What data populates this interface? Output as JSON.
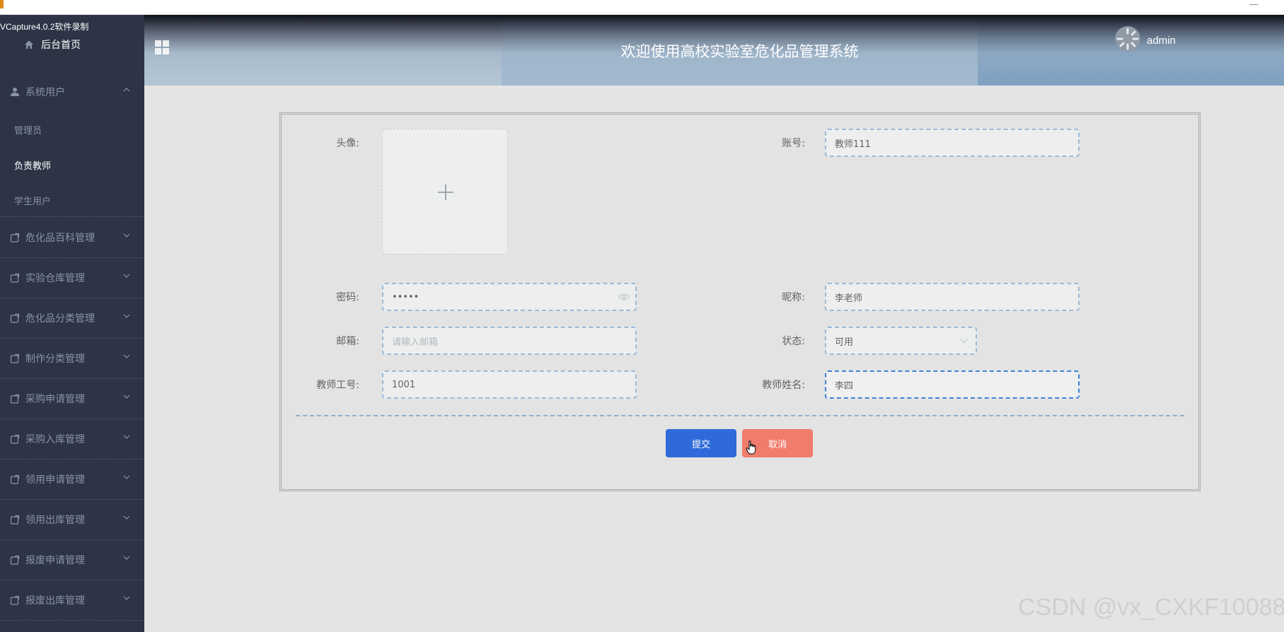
{
  "window": {
    "minimize_glyph": "—"
  },
  "recorder": {
    "label": "VCapture4.0.2软件录制"
  },
  "sidebar": {
    "home_label": "后台首页",
    "system_users": {
      "label": "系统用户",
      "items": [
        "管理员",
        "负责教师",
        "学生用户"
      ],
      "active_item": "负责教师"
    },
    "groups": [
      "危化品百科管理",
      "实验仓库管理",
      "危化品分类管理",
      "制作分类管理",
      "采购申请管理",
      "采购入库管理",
      "领用申请管理",
      "领用出库管理",
      "报废申请管理",
      "报废出库管理"
    ]
  },
  "header": {
    "title": "欢迎使用高校实验室危化品管理系统",
    "username": "admin"
  },
  "form": {
    "avatar_label": "头像:",
    "account_label": "账号:",
    "account_value": "教师111",
    "password_label": "密码:",
    "password_value": "•••••",
    "nickname_label": "昵称:",
    "nickname_value": "李老师",
    "email_label": "邮箱:",
    "email_placeholder": "请输入邮箱",
    "status_label": "状态:",
    "status_value": "可用",
    "teacher_id_label": "教师工号:",
    "teacher_id_value": "1001",
    "teacher_name_label": "教师姓名:",
    "teacher_name_value": "李四",
    "submit_label": "提交",
    "cancel_label": "取消"
  },
  "watermark": "CSDN @vx_CXKF10088",
  "colors": {
    "sidebar_bg": "#2c3445",
    "primary": "#2e6ad9",
    "danger": "#f07c6d"
  }
}
